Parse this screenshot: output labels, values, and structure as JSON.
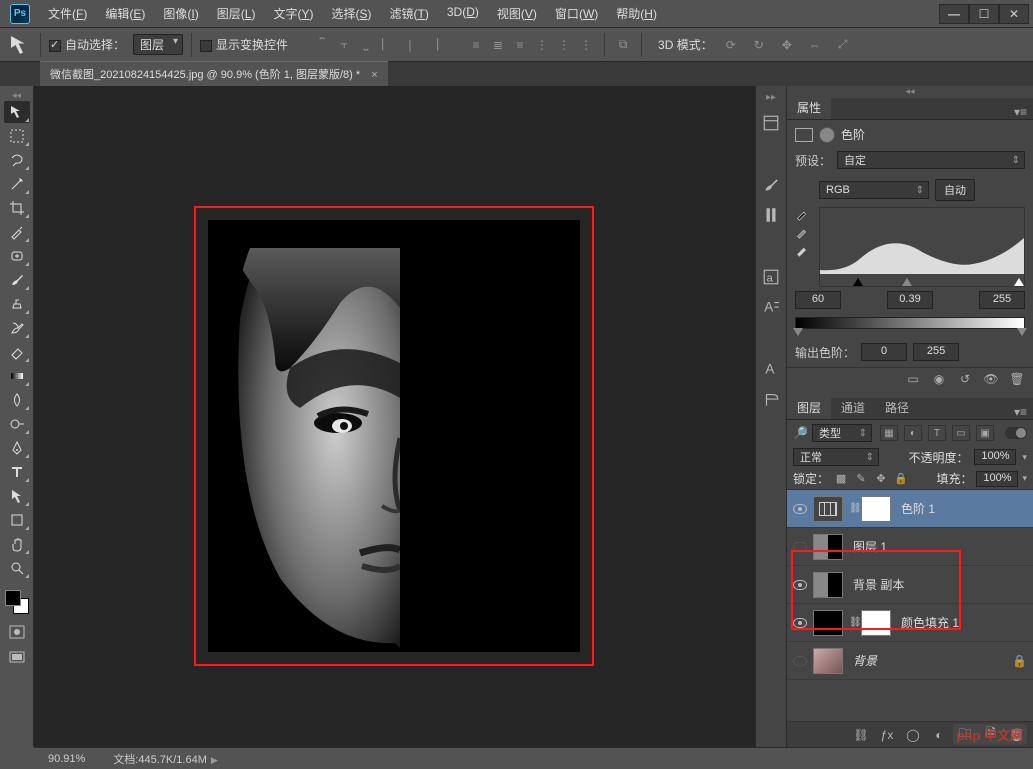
{
  "app": {
    "logo": "Ps"
  },
  "menu": {
    "file": {
      "label": "文件",
      "accel": "F"
    },
    "edit": {
      "label": "编辑",
      "accel": "E"
    },
    "image": {
      "label": "图像",
      "accel": "I"
    },
    "layer": {
      "label": "图层",
      "accel": "L"
    },
    "type": {
      "label": "文字",
      "accel": "Y"
    },
    "select": {
      "label": "选择",
      "accel": "S"
    },
    "filter": {
      "label": "滤镜",
      "accel": "T"
    },
    "threeD": {
      "label": "3D",
      "accel": "D"
    },
    "view": {
      "label": "视图",
      "accel": "V"
    },
    "window": {
      "label": "窗口",
      "accel": "W"
    },
    "help": {
      "label": "帮助",
      "accel": "H"
    }
  },
  "options": {
    "autoSelectLabel": "自动选择：",
    "autoSelectTarget": "图层",
    "showTransformLabel": "显示变换控件",
    "threeDModeLabel": "3D 模式："
  },
  "docTab": {
    "title": "微信截图_20210824154425.jpg @ 90.9% (色阶 1, 图层蒙版/8) *"
  },
  "properties": {
    "tab": "属性",
    "adjName": "色阶",
    "presetLabel": "预设：",
    "presetValue": "自定",
    "channelValue": "RGB",
    "autoBtn": "自动",
    "shadows": "60",
    "mid": "0.39",
    "high": "255",
    "outputLabel": "输出色阶：",
    "outLow": "0",
    "outHigh": "255"
  },
  "layersPanel": {
    "tabs": {
      "layers": "图层",
      "channels": "通道",
      "paths": "路径"
    },
    "kind": "类型",
    "blend": "正常",
    "opacityLabel": "不透明度：",
    "opacityValue": "100%",
    "lockLabel": "锁定：",
    "fillLabel": "填充：",
    "fillValue": "100%",
    "items": {
      "levels": {
        "name": "色阶 1"
      },
      "layer1": {
        "name": "图层 1"
      },
      "bgCopy": {
        "name": "背景 副本"
      },
      "colorFill": {
        "name": "颜色填充 1"
      },
      "bg": {
        "name": "背景"
      }
    }
  },
  "status": {
    "zoom": "90.91%",
    "doc": "文档:445.7K/1.64M"
  },
  "watermark": "php 中文网"
}
